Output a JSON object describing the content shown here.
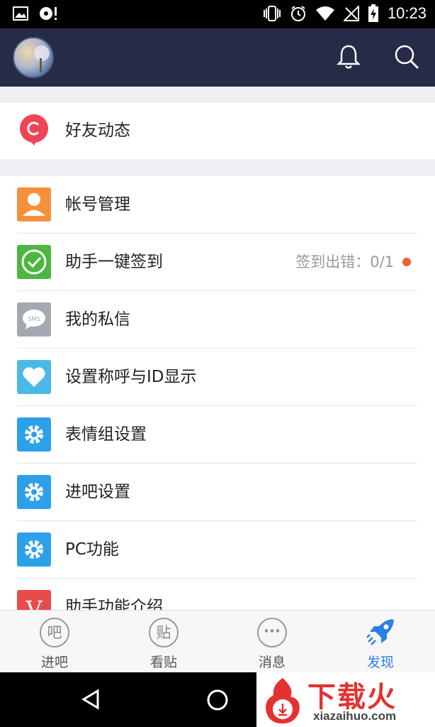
{
  "status_bar": {
    "time": "10:23",
    "icons": [
      "image-icon",
      "cd-alert-icon",
      "vibrate-icon",
      "alarm-icon",
      "wifi-icon",
      "no-signal-icon",
      "battery-charging-icon"
    ]
  },
  "header": {
    "avatar_icon": "user-avatar",
    "bell_icon": "bell-icon",
    "search_icon": "search-icon",
    "background": "#262b47"
  },
  "section1": {
    "items": [
      {
        "label": "好友动态",
        "icon": "friend-feed-icon",
        "color": "#ef4456"
      }
    ]
  },
  "section2": {
    "items": [
      {
        "label": "帐号管理",
        "icon": "account-icon",
        "color": "#f6913b"
      },
      {
        "label": "助手一键签到",
        "icon": "checkin-icon",
        "color": "#4cb640",
        "extra": "签到出错：0/1"
      },
      {
        "label": "我的私信",
        "icon": "sms-icon",
        "color": "#a3a9b1"
      },
      {
        "label": "设置称呼与ID显示",
        "icon": "heart-icon",
        "color": "#4ab9e8"
      },
      {
        "label": "表情组设置",
        "icon": "gear-icon",
        "color": "#2ca1ea"
      },
      {
        "label": "进吧设置",
        "icon": "gear-icon",
        "color": "#2ca1ea"
      },
      {
        "label": "PC功能",
        "icon": "gear-icon",
        "color": "#2ca1ea"
      },
      {
        "label": "助手功能介绍",
        "icon": "v-icon",
        "color": "#e74c4b"
      }
    ]
  },
  "tabs": [
    {
      "label": "进吧",
      "glyph": "吧",
      "active": false
    },
    {
      "label": "看贴",
      "glyph": "贴",
      "active": false
    },
    {
      "label": "消息",
      "glyph": "···",
      "active": false
    },
    {
      "label": "发现",
      "glyph": "",
      "active": true
    }
  ],
  "watermark": {
    "text": "下载火",
    "url": "xiazaihuo.com"
  },
  "accent_color": "#2d7ee6"
}
